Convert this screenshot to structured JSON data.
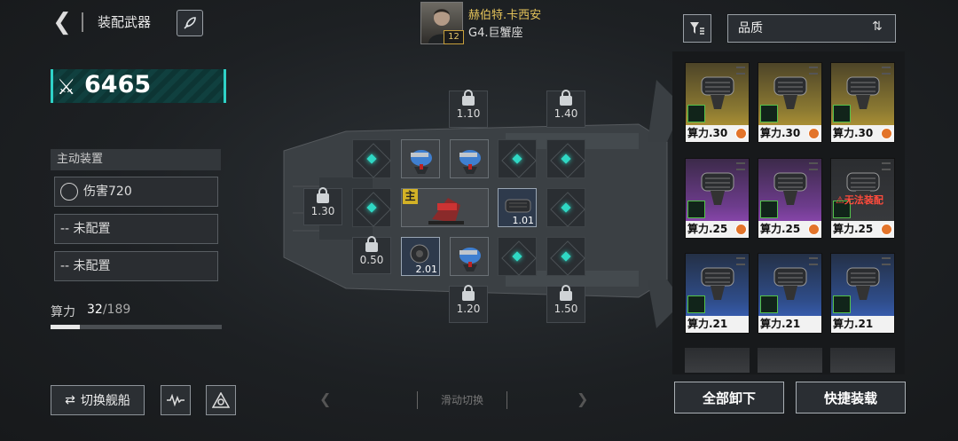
{
  "header": {
    "title": "装配武器",
    "back_icon": "back-arrow-icon",
    "rocket_icon": "rocket-icon"
  },
  "captain": {
    "name": "赫伯特.卡西安",
    "ship": "G4.巨蟹座",
    "level": "12"
  },
  "power": {
    "value": "6465"
  },
  "active": {
    "header": "主动装置",
    "slot1": "伤害720",
    "slot2": "-- 未配置",
    "slot3": "-- 未配置"
  },
  "compute": {
    "label": "算力",
    "used": "32",
    "total": "/189",
    "fraction": 0.169
  },
  "buttons": {
    "switch_ship": "切换舰船",
    "swipe": "滑动切换",
    "unequip_all": "全部卸下",
    "quick_equip": "快捷装载"
  },
  "grid": {
    "locks": [
      "1.10",
      "1.40",
      "1.30",
      "0.50",
      "1.20",
      "1.50"
    ],
    "main_badge": "主",
    "weapon_values": [
      "1.01",
      "2.01"
    ]
  },
  "sort": {
    "label": "品质"
  },
  "inventory": [
    {
      "caption": "算力.30",
      "rarity": "gold"
    },
    {
      "caption": "算力.30",
      "rarity": "gold"
    },
    {
      "caption": "算力.30",
      "rarity": "gold"
    },
    {
      "caption": "算力.25",
      "rarity": "purple"
    },
    {
      "caption": "算力.25",
      "rarity": "purple"
    },
    {
      "caption": "算力.25",
      "rarity": "dark",
      "status": "无法装配"
    },
    {
      "caption": "算力.21",
      "rarity": "blue"
    },
    {
      "caption": "算力.21",
      "rarity": "blue"
    },
    {
      "caption": "算力.21",
      "rarity": "blue"
    }
  ],
  "colors": {
    "accent": "#2fd8c4",
    "gold": "#c9a436",
    "purple": "#a24fc9",
    "blue": "#3e6ad2",
    "warn": "#ff4b3c"
  }
}
